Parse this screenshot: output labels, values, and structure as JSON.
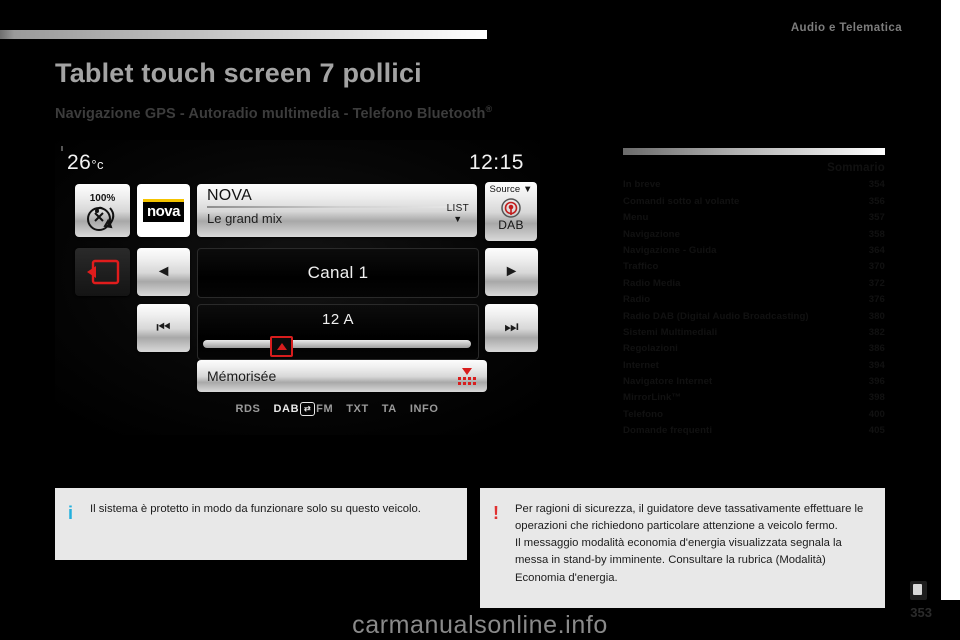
{
  "header": {
    "section_title": "Audio e Telematica"
  },
  "titles": {
    "h1": "Tablet touch screen 7 pollici",
    "h2": "Navigazione GPS - Autoradio multimedia - Telefono Bluetooth",
    "h2_sup": "®"
  },
  "screen": {
    "temperature": "26",
    "temperature_unit": "°c",
    "clock": "12:15",
    "eco_percent": "100%",
    "station_logo": "nova",
    "station_name": "NOVA",
    "station_subtitle": "Le grand mix",
    "list_label": "LIST",
    "list_caret": "▼",
    "source_label": "Source",
    "source_caret": "▼",
    "source_value": "DAB",
    "prev_arrow": "◄",
    "next_arrow": "►",
    "rewind": "⏮",
    "forward": "⏭",
    "channel": "Canal 1",
    "frequency": "12 A",
    "memorised": "Mémorisée",
    "modes": {
      "rds": "RDS",
      "dab": "DAB",
      "switch_glyph": "⇄",
      "fm": "FM",
      "txt": "TXT",
      "ta": "TA",
      "info": "INFO"
    }
  },
  "summary": {
    "title": "Sommario",
    "entries": [
      {
        "label": "In breve",
        "page": "354"
      },
      {
        "label": "Comandi sotto al volante",
        "page": "356"
      },
      {
        "label": "Menu",
        "page": "357"
      },
      {
        "label": "Navigazione",
        "page": "358"
      },
      {
        "label": "Navigazione - Guida",
        "page": "364"
      },
      {
        "label": "Traffico",
        "page": "370"
      },
      {
        "label": "Radio Media",
        "page": "372"
      },
      {
        "label": "Radio",
        "page": "376"
      },
      {
        "label": "Radio DAB (Digital Audio Broadcasting)",
        "page": "380"
      },
      {
        "label": "Sistemi Multimediali",
        "page": "382"
      },
      {
        "label": "Regolazioni",
        "page": "386"
      },
      {
        "label": "Internet",
        "page": "394"
      },
      {
        "label": "Navigatore Internet",
        "page": "396"
      },
      {
        "label": "MirrorLink™",
        "page": "398"
      },
      {
        "label": "Telefono",
        "page": "400"
      },
      {
        "label": "Domande frequenti",
        "page": "405"
      }
    ]
  },
  "notes": {
    "info": {
      "icon": "i",
      "text": "Il sistema è protetto in modo da funzionare solo su questo veicolo."
    },
    "warning": {
      "icon": "!",
      "paragraph1": "Per ragioni di sicurezza, il guidatore deve tassativamente effettuare le operazioni che richiedono particolare attenzione a veicolo fermo.",
      "paragraph2": "Il messaggio modalità economia d'energia visualizzata segnala la messa in stand-by imminente. Consultare la rubrica (Modalità) Economia d'energia."
    }
  },
  "footer": {
    "watermark": "carmanualsonline.info",
    "page_number": "353"
  }
}
